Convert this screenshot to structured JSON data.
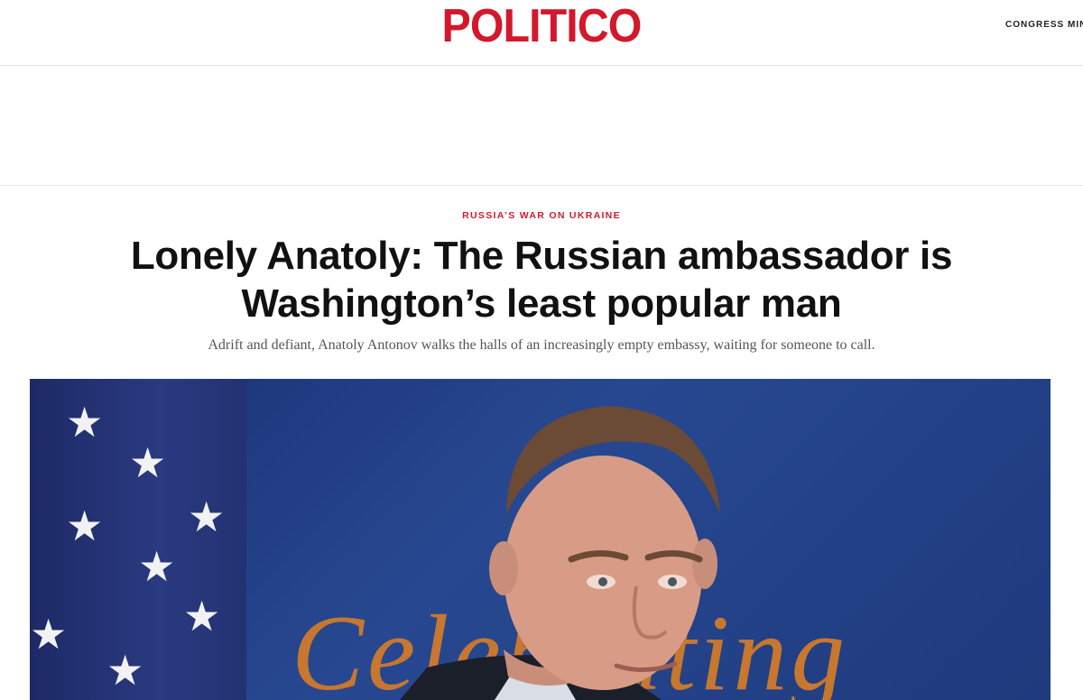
{
  "header": {
    "logo": "POLITICO",
    "nav_item": "CONGRESS MIN"
  },
  "article": {
    "category": "RUSSIA’S WAR ON UKRAINE",
    "headline": "Lonely Anatoly: The Russian ambassador is Washington’s least popular man",
    "dek": "Adrift and defiant, Anatoly Antonov walks the halls of an increasingly empty embassy, waiting for someone to call."
  },
  "hero_image": {
    "backdrop_text": "Celebrating",
    "icons": [
      "star-icon"
    ]
  },
  "colors": {
    "brand_red": "#d2192c",
    "backdrop_blue": "#274891",
    "backdrop_text_orange": "#d07a2a"
  }
}
